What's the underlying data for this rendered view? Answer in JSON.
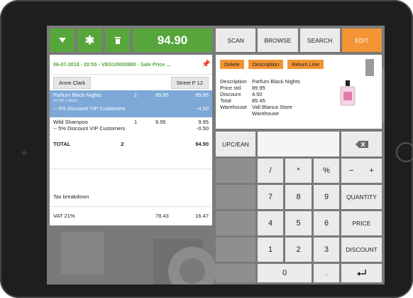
{
  "top_bar": {
    "dropdown_icon": "chevron-down-icon",
    "asterisk_icon": "asterisk-icon",
    "trash_icon": "trash-icon",
    "total": "94.90"
  },
  "receipt": {
    "header": "06-07-2018 - 20:55 - VBS1/0000880 - Sale Price ...",
    "customer": "Anne Clark",
    "address": "Street P 12",
    "lines": [
      {
        "name": "Parfum Black Nights",
        "qty": "1",
        "price": "89.95",
        "total": "89.95",
        "detail": "50 ml, Floral",
        "discount_label": "-- 5% Discount VIP Customers",
        "discount_amount": "-4.50"
      },
      {
        "name": "Wild Shampoo",
        "qty": "1",
        "price": "9.95",
        "total": "9.95",
        "discount_label": "-- 5% Discount VIP Customers",
        "discount_amount": "-0.50"
      }
    ],
    "total_label": "TOTAL",
    "total_qty": "2",
    "total_amount": "94.90",
    "tax_heading": "Tax breakdown",
    "vat": {
      "label": "VAT 21%",
      "base": "78.43",
      "amount": "16.47"
    }
  },
  "nav": {
    "scan": "SCAN",
    "browse": "BROWSE",
    "search": "SEARCH",
    "edit": "EDIT"
  },
  "detail": {
    "delete": "Delete",
    "description_btn": "Description",
    "return_line": "Return Line",
    "fields": [
      {
        "k": "Description",
        "v": "Parfum Black Nights"
      },
      {
        "k": "Price std.",
        "v": "89.95"
      },
      {
        "k": "Discount",
        "v": "4.50"
      },
      {
        "k": "Total",
        "v": "85.45"
      },
      {
        "k": "Warehouse",
        "v": "Vall Blanca Store"
      },
      {
        "k": "",
        "v": "Warehouse"
      }
    ]
  },
  "keypad": {
    "upc": "UPC/EAN",
    "backspace_icon": "backspace-icon",
    "slash": "/",
    "star": "*",
    "percent": "%",
    "minus": "−",
    "plus": "+",
    "k7": "7",
    "k8": "8",
    "k9": "9",
    "quantity": "QUANTITY",
    "k4": "4",
    "k5": "5",
    "k6": "6",
    "price": "PRICE",
    "k1": "1",
    "k2": "2",
    "k3": "3",
    "discount": "DISCOUNT",
    "k0": "0",
    "dot": ".",
    "enter_icon": "enter-icon"
  },
  "colors": {
    "green": "#57a63b",
    "orange": "#f39434",
    "selected": "#7ea8d8"
  }
}
